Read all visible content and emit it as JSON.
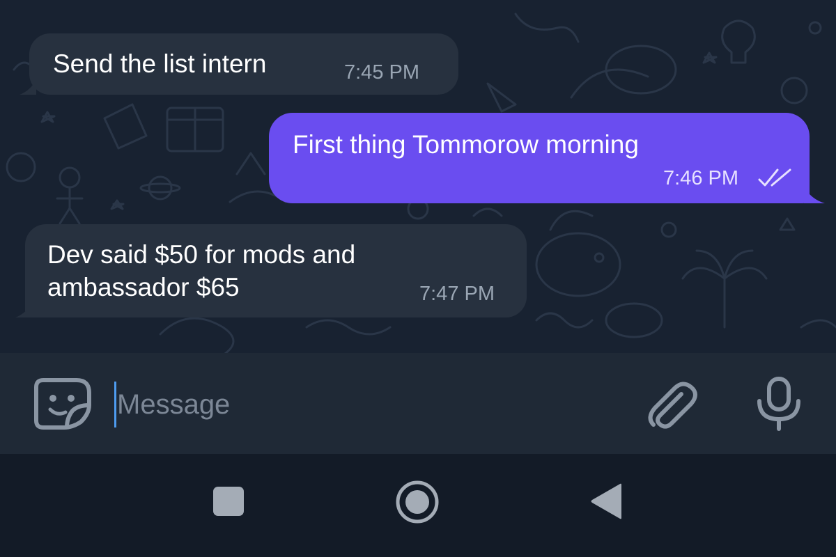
{
  "conversation": {
    "messages": [
      {
        "direction": "incoming",
        "text": "Send the list intern",
        "time": "7:45 PM"
      },
      {
        "direction": "outgoing",
        "text": "First thing Tommorow morning",
        "time": "7:46 PM",
        "read_status": "double-check-icon"
      },
      {
        "direction": "incoming",
        "text": "Dev said $50 for mods and ambassador $65",
        "time": "7:47 PM"
      }
    ]
  },
  "composer": {
    "placeholder": "Message",
    "value": "",
    "left_icon": "sticker-icon",
    "right_icons": [
      "paperclip-icon",
      "microphone-icon"
    ]
  },
  "navigation": {
    "buttons": [
      "recents-square-icon",
      "home-circle-icon",
      "back-triangle-icon"
    ]
  },
  "colors": {
    "chat_background": "#182231",
    "incoming_bubble": "#27313f",
    "outgoing_bubble": "#6a4df0",
    "input_bar": "#1f2936",
    "nav_bar": "#131b27",
    "caret": "#4e9cf0"
  }
}
